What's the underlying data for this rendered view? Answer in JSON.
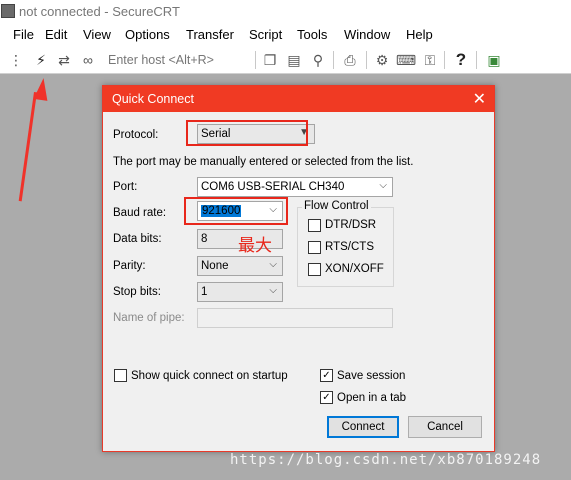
{
  "window": {
    "title": "not connected - SecureCRT"
  },
  "menu": [
    "File",
    "Edit",
    "View",
    "Options",
    "Transfer",
    "Script",
    "Tools",
    "Window",
    "Help"
  ],
  "toolbar": {
    "enter_host_label": "Enter host <Alt+R>",
    "icons": [
      "connect-bar-icon",
      "quick-connect-icon",
      "reconnect-icon",
      "disconnect-icon",
      "copy-icon",
      "paste-icon",
      "find-icon",
      "print-icon",
      "session-options-icon",
      "keymap-icon",
      "sftp-icon",
      "help-icon",
      "trace-icon"
    ]
  },
  "dialog": {
    "title": "Quick Connect",
    "protocol_label": "Protocol:",
    "protocol_value": "Serial",
    "hint": "The port may be manually entered or selected from the list.",
    "port_label": "Port:",
    "port_value": "COM6 USB-SERIAL CH340",
    "baud_label": "Baud rate:",
    "baud_value": "921600",
    "databits_label": "Data bits:",
    "databits_value": "8",
    "parity_label": "Parity:",
    "parity_value": "None",
    "stopbits_label": "Stop bits:",
    "stopbits_value": "1",
    "pipe_label": "Name of pipe:",
    "pipe_value": "",
    "flow_control": {
      "title": "Flow Control",
      "dtr_dsr": {
        "label": "DTR/DSR",
        "checked": false
      },
      "rts_cts": {
        "label": "RTS/CTS",
        "checked": false
      },
      "xon_xoff": {
        "label": "XON/XOFF",
        "checked": false
      }
    },
    "show_on_startup": {
      "label": "Show quick connect on startup",
      "checked": false
    },
    "save_session": {
      "label": "Save session",
      "checked": true
    },
    "open_in_tab": {
      "label": "Open in a tab",
      "checked": true
    },
    "connect_label": "Connect",
    "cancel_label": "Cancel"
  },
  "annotation": {
    "text": "最大",
    "color": "#e8271b"
  },
  "watermark": "https://blog.csdn.net/xb870189248",
  "colors": {
    "dialog_titlebar": "#f03a23",
    "selection": "#0078d7",
    "annotation": "#e8271b"
  }
}
